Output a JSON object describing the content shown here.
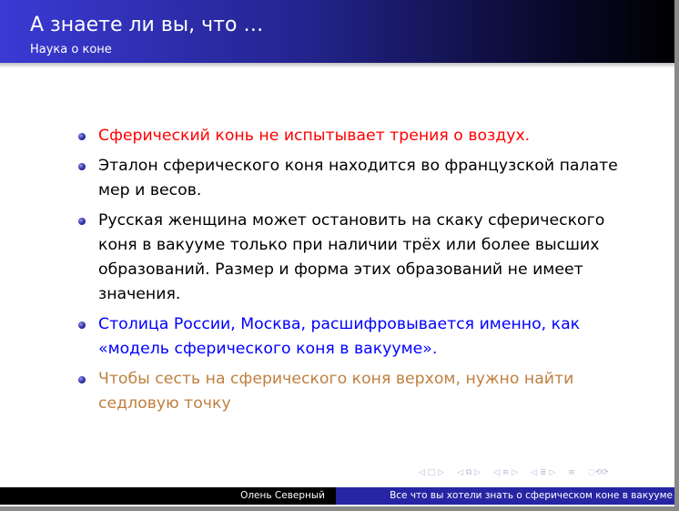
{
  "header": {
    "title": "А знаете ли вы, что …",
    "subtitle": "Наука о коне"
  },
  "items": [
    {
      "text": "Сферический конь не испытывает трения о воздух.",
      "color": "#ff0000"
    },
    {
      "text": "Эталон сферического коня находится во французской палате мер и весов.",
      "color": "#000000"
    },
    {
      "text": "Русская женщина может остановить на скаку сферического коня в вакууме только при наличии трёх или более высших образований. Размер и форма этих образований не имеет значения.",
      "color": "#000000"
    },
    {
      "text": "Столица России, Москва, расшифровывается именно, как «модель сферического коня в вакууме».",
      "color": "#0000ff"
    },
    {
      "text": "Чтобы сесть на сферического коня верхом, нужно найти седловую точку",
      "color": "#bf8040"
    }
  ],
  "navigation": {
    "frame": "◁ □ ▷",
    "subsection": "◁ ⧉ ▷",
    "section": "◁ ≡ ▷",
    "subsubsection": "◁ ≣ ▷",
    "align": "≡",
    "search": "◌⟲⟳"
  },
  "footer": {
    "author": "Олень Северный",
    "title": "Все что вы хотели знать о сферическом коне в вакууме"
  }
}
